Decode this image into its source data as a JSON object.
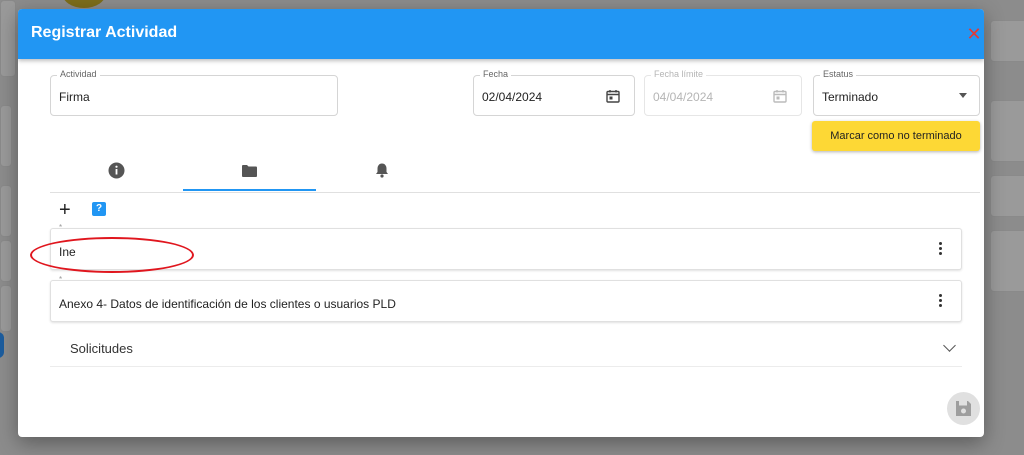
{
  "modal": {
    "title": "Registrar Actividad",
    "close_label": "✕"
  },
  "form": {
    "actividad": {
      "label": "Actividad",
      "value": "Firma"
    },
    "fecha": {
      "label": "Fecha",
      "value": "02/04/2024"
    },
    "fecha_limite": {
      "label": "Fecha límite",
      "value": "04/04/2024"
    },
    "estatus": {
      "label": "Estatus",
      "value": "Terminado"
    },
    "mark_button": "Marcar como no terminado"
  },
  "tabs": [
    {
      "icon": "info-icon",
      "active": false
    },
    {
      "icon": "folder-icon",
      "active": true
    },
    {
      "icon": "bell-icon",
      "active": false
    }
  ],
  "toolbar": {
    "add_label": "+",
    "help_label": "?"
  },
  "documents": [
    {
      "required_mark": "*",
      "name": "Ine"
    },
    {
      "required_mark": "*",
      "name": "Anexo 4- Datos de identificación de los clientes o usuarios PLD"
    }
  ],
  "accordion": {
    "label": "Solicitudes"
  },
  "colors": {
    "header": "#2196f3",
    "warn_button": "#fdd835",
    "close": "#e53935",
    "highlight": "#e0161e"
  }
}
